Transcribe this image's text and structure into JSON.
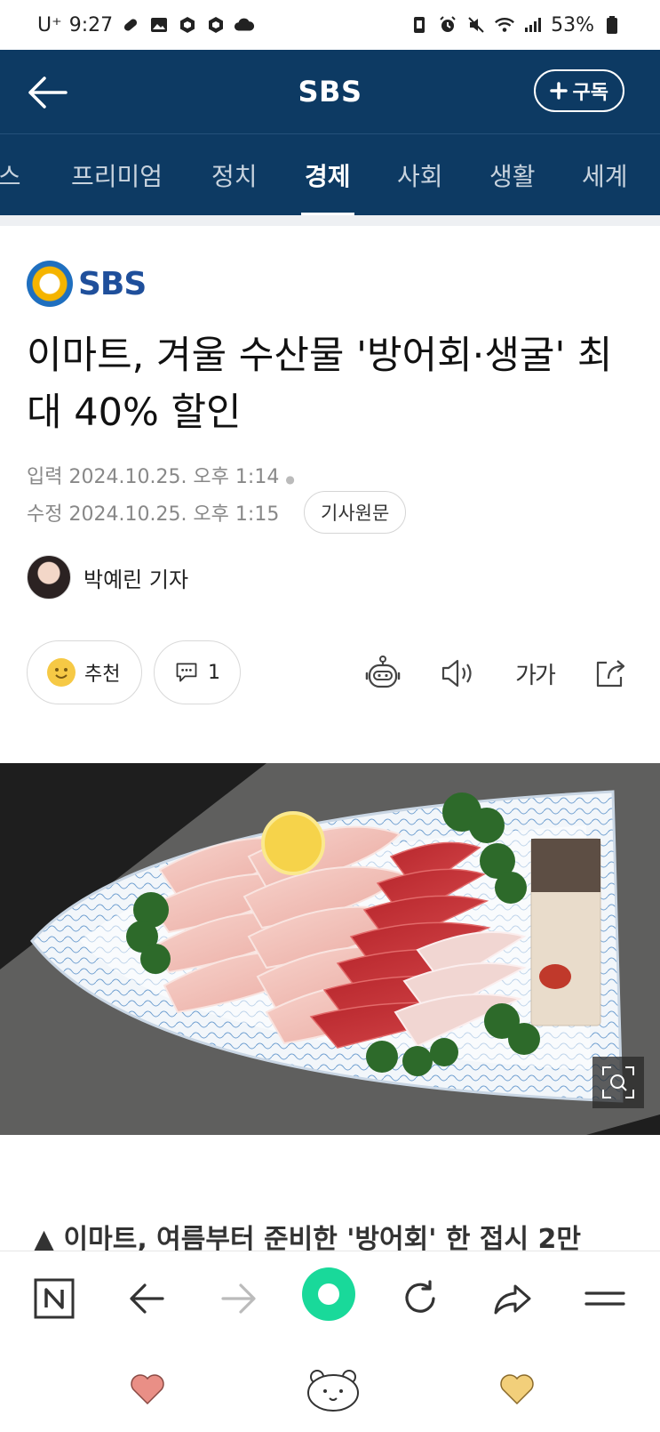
{
  "status_bar": {
    "carrier": "U⁺",
    "time": "9:27",
    "battery": "53%"
  },
  "header": {
    "title": "SBS",
    "subscribe_label": "구독"
  },
  "tabs": [
    {
      "label": "뉴스"
    },
    {
      "label": "프리미엄"
    },
    {
      "label": "정치"
    },
    {
      "label": "경제"
    },
    {
      "label": "사회"
    },
    {
      "label": "생활"
    },
    {
      "label": "세계"
    }
  ],
  "article": {
    "press_name": "SBS",
    "headline": "이마트, 겨울 수산물 '방어회·생굴' 최대 40% 할인",
    "input_label": "입력",
    "input_time": "2024.10.25. 오후 1:14",
    "modified_label": "수정",
    "modified_time": "2024.10.25. 오후 1:15",
    "original_button": "기사원문",
    "reporter": "박예린 기자",
    "recommend_label": "추천",
    "comment_count": "1",
    "font_size_label": "가가",
    "caption": "▲ 이마트, 여름부터 준비한 '방어회' 한 접시 2만"
  },
  "colors": {
    "header_bg": "#0d3a63",
    "accent_green": "#19d99a"
  }
}
